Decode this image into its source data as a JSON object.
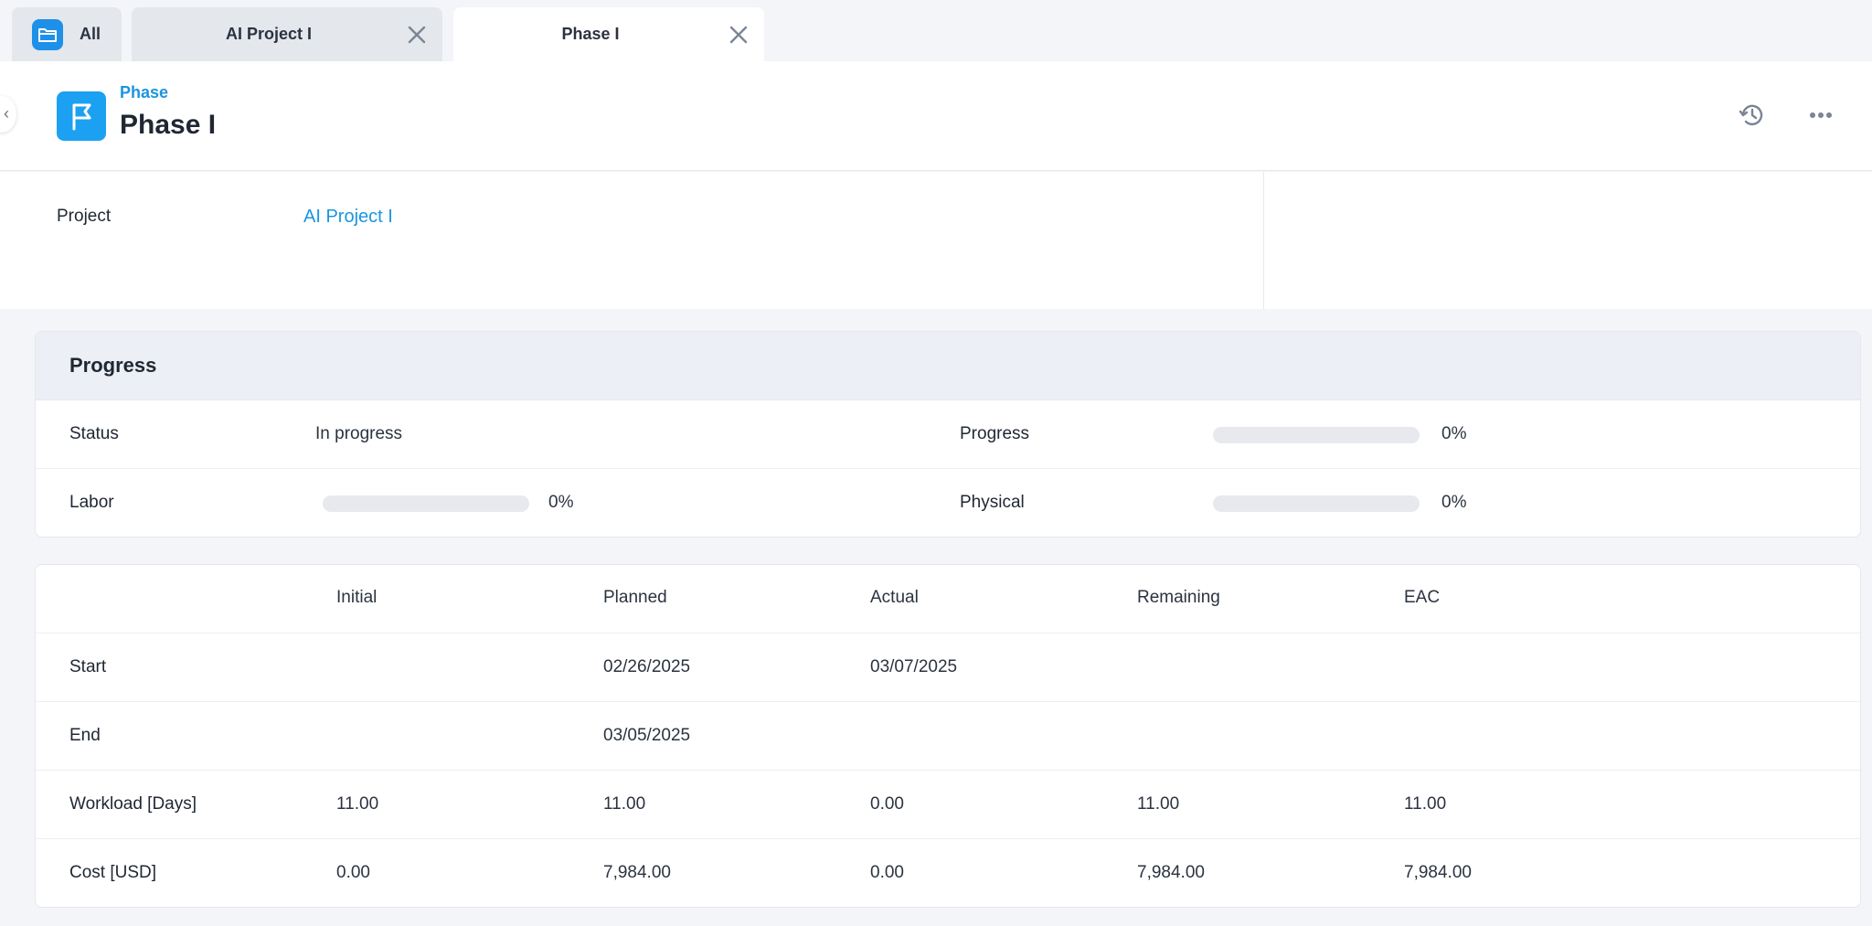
{
  "tabs": {
    "all_label": "All",
    "project_label": "AI Project I",
    "phase_label": "Phase I"
  },
  "header": {
    "type_label": "Phase",
    "title": "Phase I"
  },
  "info": {
    "project_label": "Project",
    "project_value": "AI Project I"
  },
  "progress": {
    "title": "Progress",
    "status_label": "Status",
    "status_value": "In progress",
    "progress_label": "Progress",
    "progress_value": "0%",
    "progress_fraction": 0,
    "labor_label": "Labor",
    "labor_value": "0%",
    "labor_fraction": 0,
    "physical_label": "Physical",
    "physical_value": "0%",
    "physical_fraction": 0
  },
  "table": {
    "columns": [
      "Initial",
      "Planned",
      "Actual",
      "Remaining",
      "EAC"
    ],
    "rows": [
      {
        "label": "Start",
        "cells": [
          "",
          "02/26/2025",
          "03/07/2025",
          "",
          ""
        ]
      },
      {
        "label": "End",
        "cells": [
          "",
          "03/05/2025",
          "",
          "",
          ""
        ]
      },
      {
        "label": "Workload [Days]",
        "cells": [
          "11.00",
          "11.00",
          "0.00",
          "11.00",
          "11.00"
        ]
      },
      {
        "label": "Cost [USD]",
        "cells": [
          "0.00",
          "7,984.00",
          "0.00",
          "7,984.00",
          "7,984.00"
        ]
      }
    ]
  },
  "colors": {
    "accent": "#1ca0f2",
    "link": "#1b95e0",
    "tab_active_bg": "#ffffff",
    "tab_inactive_bg": "#e4e7ec"
  },
  "icons": {
    "all_tab": "folder-icon",
    "header": "flag-icon",
    "history": "history-icon",
    "more": "more-horizontal-icon",
    "close": "close-icon",
    "back": "chevron-left-icon"
  }
}
